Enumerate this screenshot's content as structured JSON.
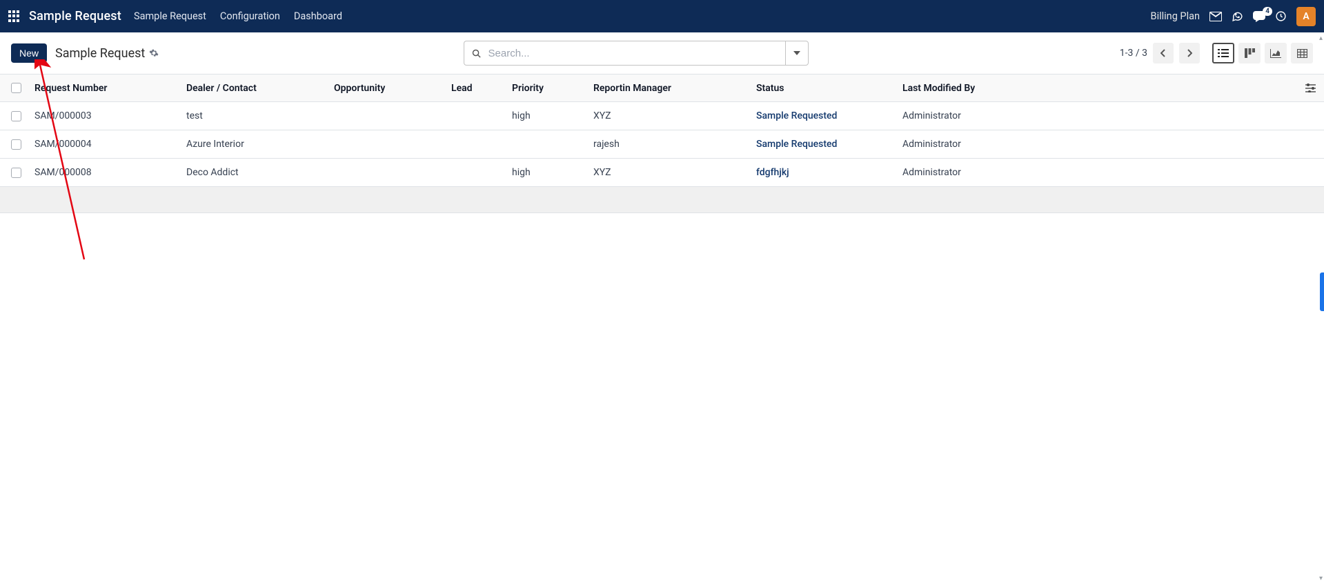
{
  "navbar": {
    "brand": "Sample Request",
    "links": [
      "Sample Request",
      "Configuration",
      "Dashboard"
    ],
    "billing": "Billing Plan",
    "chat_badge": "4",
    "avatar_letter": "A"
  },
  "controlbar": {
    "new_label": "New",
    "breadcrumb": "Sample Request",
    "search_placeholder": "Search...",
    "pager_text": "1-3 / 3"
  },
  "table": {
    "columns": [
      "Request Number",
      "Dealer / Contact",
      "Opportunity",
      "Lead",
      "Priority",
      "Reportin Manager",
      "Status",
      "Last Modified By"
    ],
    "rows": [
      {
        "request_number": "SAM/000003",
        "dealer": "test",
        "opportunity": "",
        "lead": "",
        "priority": "high",
        "manager": "XYZ",
        "status": "Sample Requested",
        "modified_by": "Administrator"
      },
      {
        "request_number": "SAM/000004",
        "dealer": "Azure Interior",
        "opportunity": "",
        "lead": "",
        "priority": "",
        "manager": "rajesh",
        "status": "Sample Requested",
        "modified_by": "Administrator"
      },
      {
        "request_number": "SAM/000008",
        "dealer": "Deco Addict",
        "opportunity": "",
        "lead": "",
        "priority": "high",
        "manager": "XYZ",
        "status": "fdgfhjkj",
        "modified_by": "Administrator"
      }
    ]
  }
}
